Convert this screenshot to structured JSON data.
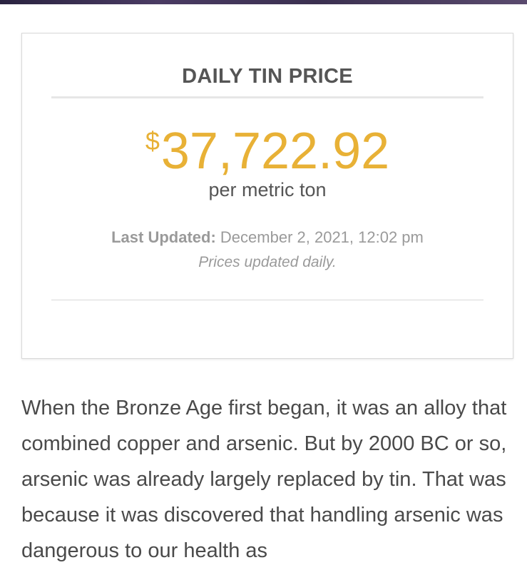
{
  "widget": {
    "title": "DAILY TIN PRICE",
    "currency_symbol": "$",
    "price": "37,722.92",
    "unit": "per metric ton",
    "last_updated_label": "Last Updated:",
    "last_updated_value": "December 2, 2021, 12:02 pm",
    "note": "Prices updated daily."
  },
  "article": {
    "paragraph": "When the Bronze Age first began, it was an alloy that combined copper and arsenic. But by 2000 BC or so, arsenic was already largely replaced by tin. That was because it was discovered that handling arsenic was dangerous to our health as"
  },
  "colors": {
    "price_accent": "#e8b136",
    "heading": "#555555",
    "muted": "#9a9a9a",
    "body_text": "#4a4a4a"
  }
}
